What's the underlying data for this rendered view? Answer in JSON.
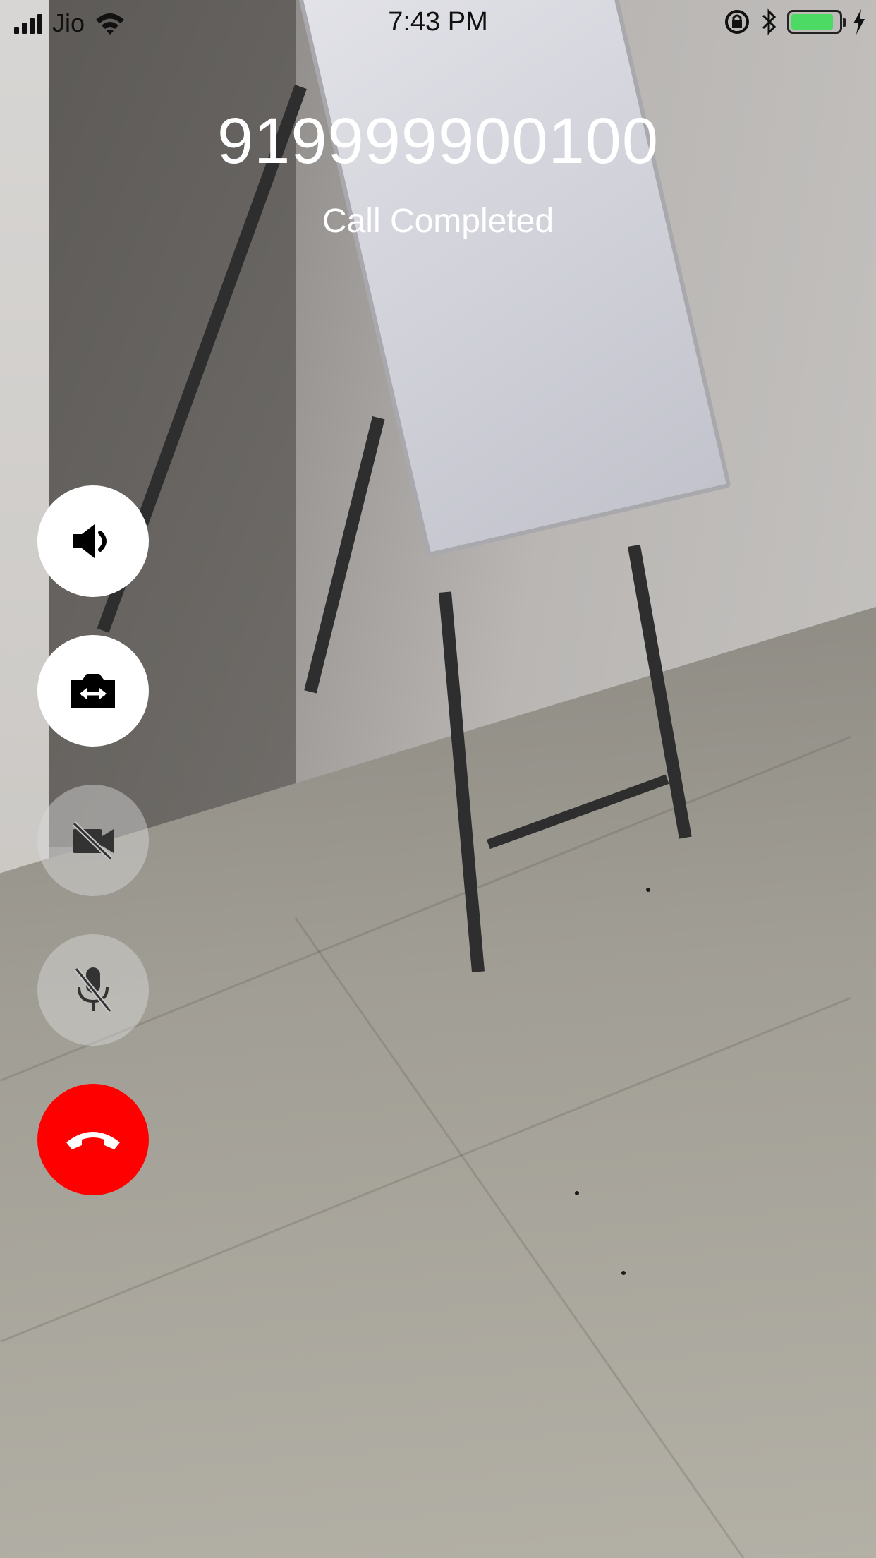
{
  "status_bar": {
    "carrier": "Jio",
    "time": "7:43 PM",
    "battery_level": 0.9,
    "icons": [
      "signal-icon",
      "wifi-icon",
      "orientation-lock-icon",
      "bluetooth-icon",
      "battery-icon",
      "charging-icon"
    ]
  },
  "call": {
    "number": "919999900100",
    "status": "Call Completed"
  },
  "controls": [
    {
      "name": "speaker",
      "icon": "speaker-icon",
      "state": "on"
    },
    {
      "name": "switch-camera",
      "icon": "switch-camera-icon",
      "state": "on"
    },
    {
      "name": "video-off",
      "icon": "video-off-icon",
      "state": "disabled"
    },
    {
      "name": "mute",
      "icon": "mic-off-icon",
      "state": "disabled"
    },
    {
      "name": "end-call",
      "icon": "end-call-icon",
      "state": "active"
    }
  ],
  "colors": {
    "end_call": "#ff0000",
    "battery": "#4cd964",
    "text": "#ffffff"
  }
}
